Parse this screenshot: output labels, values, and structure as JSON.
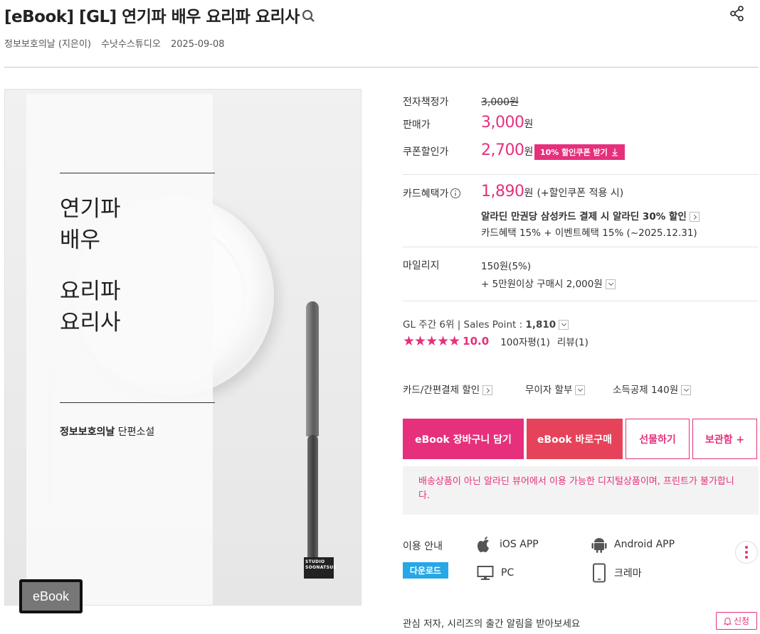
{
  "product": {
    "title": "[eBook] [GL] 연기파 배우 요리파 요리사",
    "author": "정보보호의날 (지은이)",
    "publisher": "수낫수스튜디오",
    "date": "2025-09-08",
    "format_badge": "eBook"
  },
  "cover": {
    "title_line1": "연기파\n배우",
    "title_line2": "요리파\n요리사",
    "author_name": "정보보호의날",
    "author_suffix": " 단편소설",
    "studio_mark": "STUDIO SOONATSUE"
  },
  "price": {
    "list_label": "전자책정가",
    "list_value": "3,000원",
    "sale_label": "판매가",
    "sale_value": "3,000",
    "coupon_label": "쿠폰할인가",
    "coupon_value": "2,700",
    "currency": "원",
    "coupon_button": "10% 할인쿠폰 받기"
  },
  "card": {
    "label": "카드혜택가",
    "value": "1,890",
    "note": "(+할인쿠폰 적용 시)",
    "promo": "알라딘 만권당 삼성카드 결제 시 알라딘 30% 할인",
    "detail": "카드혜택 15% + 이벤트혜택 15% (~2025.12.31)"
  },
  "mileage": {
    "label": "마일리지",
    "value": "150원(5%)",
    "extra": "+ 5만원이상 구매시 2,000원"
  },
  "rank": {
    "text": "GL 주간 6위  |  Sales Point : ",
    "points": "1,810",
    "rating": "10.0",
    "reviews100": "100자평(1)",
    "reviews": "리뷰(1)"
  },
  "options": {
    "card_discount": "카드/간편결제 할인",
    "installment": "무이자 할부",
    "tax": "소득공제 140원"
  },
  "buttons": {
    "cart": "eBook 장바구니 담기",
    "buy": "eBook 바로구매",
    "gift": "선물하기",
    "keep": "보관함 +"
  },
  "notice": "배송상품이 아닌 알라딘 뷰어에서 이용 가능한 디지털상품이며, 프린트가 불가합니다.",
  "usage": {
    "label": "이용 안내",
    "download": "다운로드",
    "ios": "iOS APP",
    "android": "Android APP",
    "pc": "PC",
    "crema": "크레마"
  },
  "alert": {
    "text": "관심 저자, 시리즈의 출간 알림을 받아보세요",
    "button": "신청"
  },
  "colors": {
    "accent": "#e6307c",
    "buy": "#e6435a",
    "download": "#27a7e7"
  }
}
